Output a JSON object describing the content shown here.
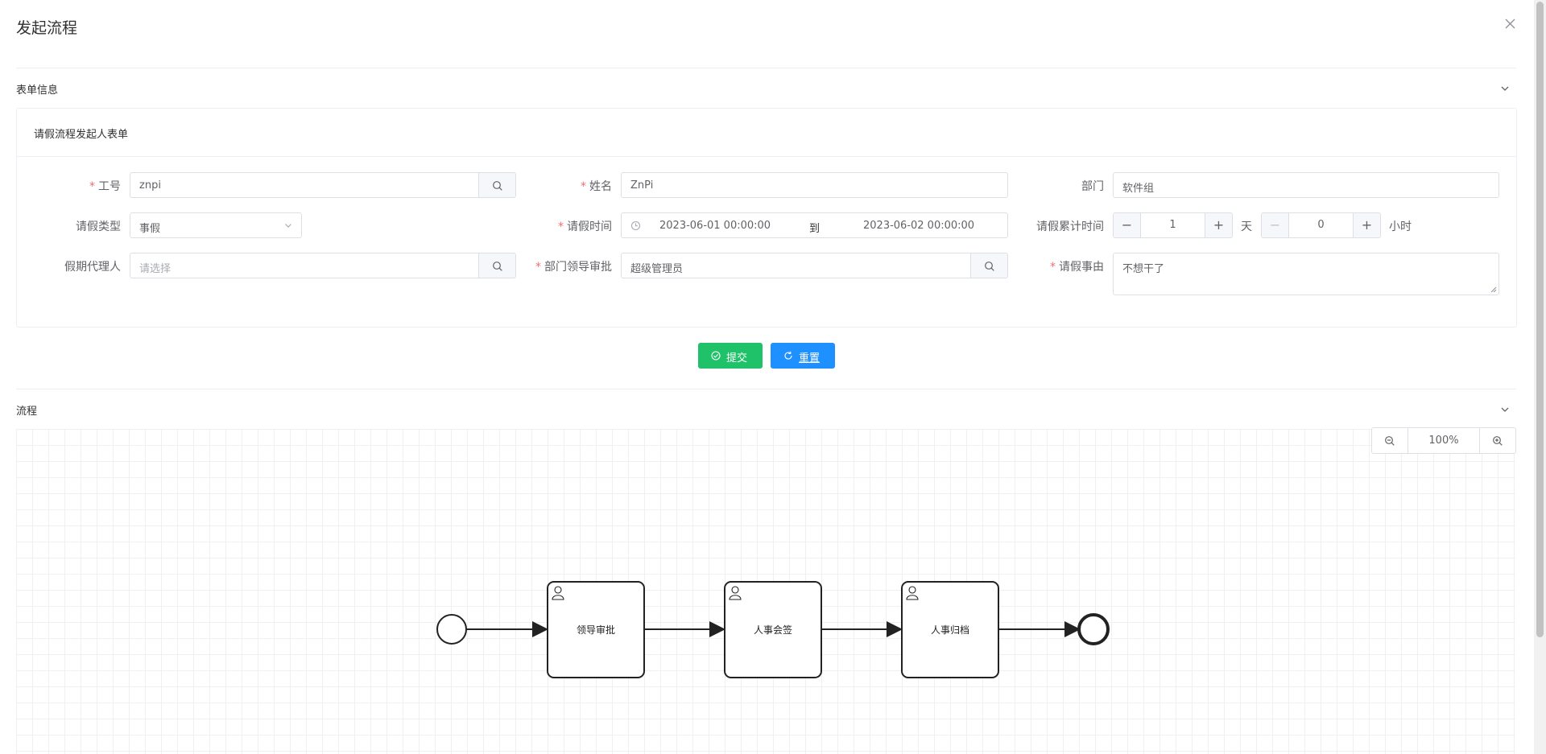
{
  "dialog": {
    "title": "发起流程"
  },
  "form_section": {
    "title": "表单信息"
  },
  "form_card": {
    "title": "请假流程发起人表单"
  },
  "fields": {
    "employee_id": {
      "label": "工号",
      "value": "znpi"
    },
    "name": {
      "label": "姓名",
      "value": "ZnPi"
    },
    "department": {
      "label": "部门",
      "value": "软件组"
    },
    "leave_type": {
      "label": "请假类型",
      "value": "事假"
    },
    "leave_time": {
      "label": "请假时间",
      "start": "2023-06-01 00:00:00",
      "separator": "到",
      "end": "2023-06-02 00:00:00"
    },
    "leave_total": {
      "label": "请假累计时间",
      "days": "1",
      "days_unit": "天",
      "hours": "0",
      "hours_unit": "小时"
    },
    "agent": {
      "label": "假期代理人",
      "placeholder": "请选择"
    },
    "dept_leader": {
      "label": "部门领导审批",
      "value": "超级管理员"
    },
    "reason": {
      "label": "请假事由",
      "value": "不想干了"
    }
  },
  "buttons": {
    "submit": "提交",
    "reset": "重置"
  },
  "flow_section": {
    "title": "流程",
    "zoom": "100%",
    "tasks": [
      "领导审批",
      "人事会签",
      "人事归档"
    ]
  },
  "colors": {
    "success": "#1fc269",
    "primary": "#1e90ff",
    "required": "#f56c6c"
  },
  "icons": [
    "close-icon",
    "chevron-down-icon",
    "search-icon",
    "clock-icon",
    "check-circle-icon",
    "refresh-icon",
    "zoom-out-icon",
    "zoom-in-icon",
    "user-task-icon"
  ]
}
